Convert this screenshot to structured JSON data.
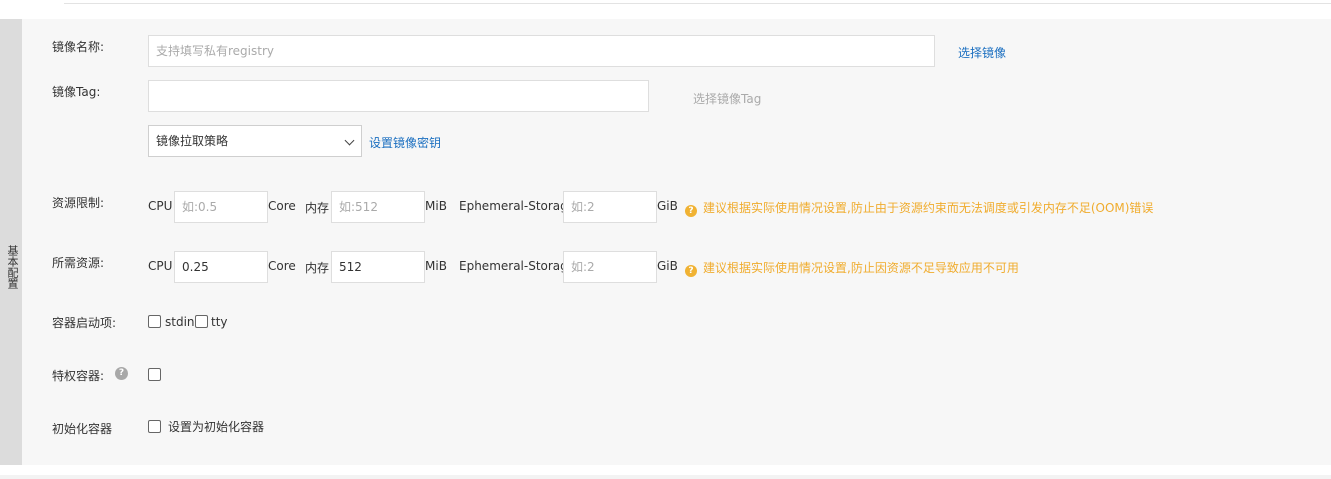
{
  "side_tab": {
    "label": "基本配置"
  },
  "image": {
    "name_label": "镜像名称:",
    "name_placeholder": "支持填写私有registry",
    "select_image_link": "选择镜像",
    "tag_label": "镜像Tag:",
    "tag_value": "",
    "select_tag_link": "选择镜像Tag",
    "pull_policy_value": "镜像拉取策略",
    "set_secret_link": "设置镜像密钥"
  },
  "limits": {
    "label": "资源限制:",
    "cpu_label": "CPU",
    "cpu_placeholder": "如:0.5",
    "cpu_unit": "Core",
    "mem_label": "内存",
    "mem_placeholder": "如:512",
    "mem_unit": "MiB",
    "eph_label": "Ephemeral-Storage",
    "eph_placeholder": "如:2",
    "eph_unit": "GiB",
    "hint": "建议根据实际使用情况设置,防止由于资源约束而无法调度或引发内存不足(OOM)错误"
  },
  "requests": {
    "label": "所需资源:",
    "cpu_label": "CPU",
    "cpu_value": "0.25",
    "cpu_unit": "Core",
    "mem_label": "内存",
    "mem_value": "512",
    "mem_unit": "MiB",
    "eph_label": "Ephemeral-Storage",
    "eph_placeholder": "如:2",
    "eph_unit": "GiB",
    "hint": "建议根据实际使用情况设置,防止因资源不足导致应用不可用"
  },
  "startup": {
    "label": "容器启动项:",
    "stdin_label": "stdin",
    "stdin_checked": false,
    "tty_label": "tty",
    "tty_checked": false
  },
  "privileged": {
    "label": "特权容器:",
    "checked": false
  },
  "init_container": {
    "label": "初始化容器",
    "option_label": "设置为初始化容器",
    "checked": false
  },
  "colors": {
    "link": "#1b6fc0",
    "warn": "#f0ac2e",
    "panel_bg": "#f7f7f7"
  },
  "icons": {
    "hint": "question-circle-icon",
    "help": "question-circle-icon",
    "select": "chevron-down-icon"
  }
}
